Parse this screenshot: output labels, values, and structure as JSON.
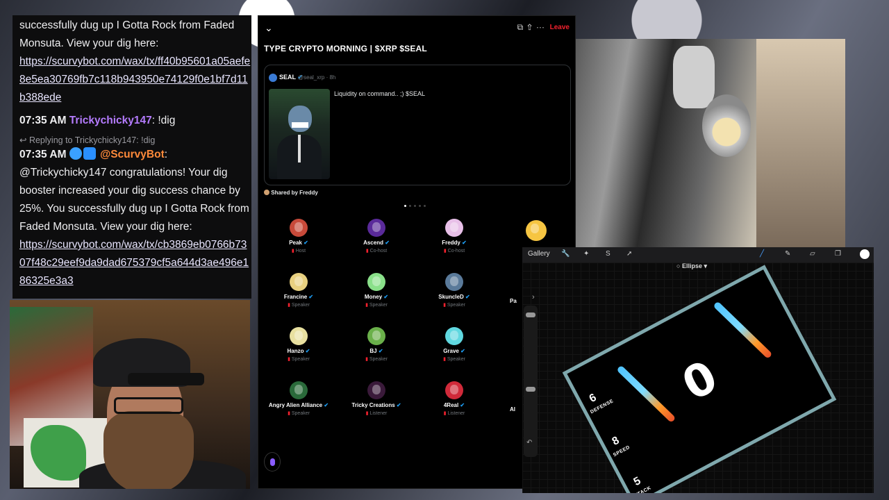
{
  "chat": {
    "lines": {
      "msg1_text": "successfully dug up I Gotta Rock from Faded Monsuta. View your dig here:",
      "msg1_link": "https://scurvybot.com/wax/tx/ff40b95601a05aefe8e5ea30769fb7c118b943950e74129f0e1bf7d11b388ede",
      "msg2_time": "07:35 AM",
      "msg2_user": "Trickychicky147",
      "msg2_text": ": !dig",
      "reply_to": "Replying to Trickychicky147: !dig",
      "msg3_time": "07:35 AM",
      "msg3_user": "@ScurvyBot",
      "msg3_text": "@Trickychicky147 congratulations! Your dig booster increased your dig success chance by 25%. You successfully dug up I Gotta Rock from Faded Monsuta. View your dig here:",
      "msg3_link": "https://scurvybot.com/wax/tx/cb3869eb0766b7307f48c29eef9da9dad675379cf5a644d3ae496e186325e3a3"
    }
  },
  "space": {
    "leave_label": "Leave",
    "title": "TYPE CRYPTO MORNING | $XRP $SEAL",
    "tweet": {
      "name": "SEAL",
      "handle": "@seal_xrp · 8h",
      "text": "Liquidity on command.. ;) $SEAL"
    },
    "shared_by": "Shared by Freddy",
    "participants": [
      {
        "name": "Peak",
        "role": "Host",
        "color": "#c84a3a"
      },
      {
        "name": "Ascend",
        "role": "Co-host",
        "color": "#5a2a9a"
      },
      {
        "name": "Freddy",
        "role": "Co-host",
        "color": "#e8c0e8"
      },
      {
        "name": "Francine",
        "role": "Speaker",
        "color": "#e8d080"
      },
      {
        "name": "Money",
        "role": "Speaker",
        "color": "#8ae08a"
      },
      {
        "name": "SkuncleD",
        "role": "Speaker",
        "color": "#5a7a9a"
      },
      {
        "name": "Hanzo",
        "role": "Speaker",
        "color": "#e8e0a0"
      },
      {
        "name": "BJ",
        "role": "Speaker",
        "color": "#6ab04a"
      },
      {
        "name": "Grave",
        "role": "Speaker",
        "color": "#60d8e0"
      },
      {
        "name": "Angry Alien Alliance",
        "role": "Speaker",
        "color": "#2a6a3a"
      },
      {
        "name": "Tricky Creations",
        "role": "Listener",
        "color": "#3a1a3a"
      },
      {
        "name": "4Real",
        "role": "Listener",
        "color": "#d02a3a"
      }
    ],
    "partial_names": [
      "Pa",
      "Al"
    ]
  },
  "draw": {
    "gallery_label": "Gallery",
    "ellipse_label": "Ellipse",
    "card": {
      "big_number": "0",
      "defense_value": "6",
      "defense_label": "DEFENSE",
      "speed_value": "8",
      "speed_label": "SPEED",
      "attack_value": "5",
      "attack_label": "TTACK"
    }
  },
  "icons": [
    "chevron-down-icon",
    "copy-icon",
    "share-icon",
    "more-icon",
    "mic-icon",
    "people-icon",
    "wrench-icon",
    "magic-icon",
    "selection-icon",
    "move-icon",
    "brush-icon",
    "smudge-icon",
    "eraser-icon",
    "layers-icon",
    "color-icon",
    "undo-icon"
  ]
}
